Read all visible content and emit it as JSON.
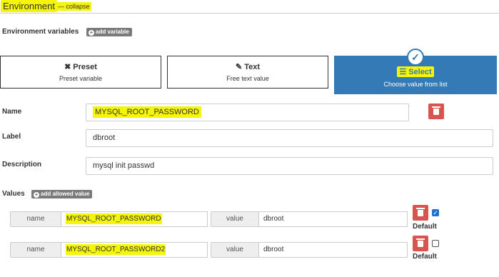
{
  "header": {
    "title": "Environment",
    "collapse_label": "— collapse"
  },
  "env_vars": {
    "label": "Environment variables",
    "add_button": "add variable"
  },
  "types": [
    {
      "icon": "user-slash-icon",
      "title": "Preset",
      "subtitle": "Preset variable",
      "active": false
    },
    {
      "icon": "edit-icon",
      "title": "Text",
      "subtitle": "Free text value",
      "active": false
    },
    {
      "icon": "list-icon",
      "title": "Select",
      "subtitle": "Choose value from list",
      "active": true
    }
  ],
  "form": {
    "name_label": "Name",
    "name_value": "MYSQL_ROOT_PASSWORD",
    "label_label": "Label",
    "label_value": "dbroot",
    "description_label": "Description",
    "description_value": "mysql init passwd"
  },
  "values": {
    "label": "Values",
    "add_button": "add allowed value",
    "rows": [
      {
        "name_addon": "name",
        "name": "MYSQL_ROOT_PASSWORD",
        "value_addon": "value",
        "value": "dbroot",
        "default": true,
        "default_label": "Default"
      },
      {
        "name_addon": "name",
        "name": "MYSQL_ROOT_PASSWORD2",
        "value_addon": "value",
        "value": "dbroot",
        "default": false,
        "default_label": "Default"
      }
    ]
  },
  "colors": {
    "highlight": "#f5f50a",
    "primary": "#337ab7",
    "danger": "#d9534f"
  }
}
